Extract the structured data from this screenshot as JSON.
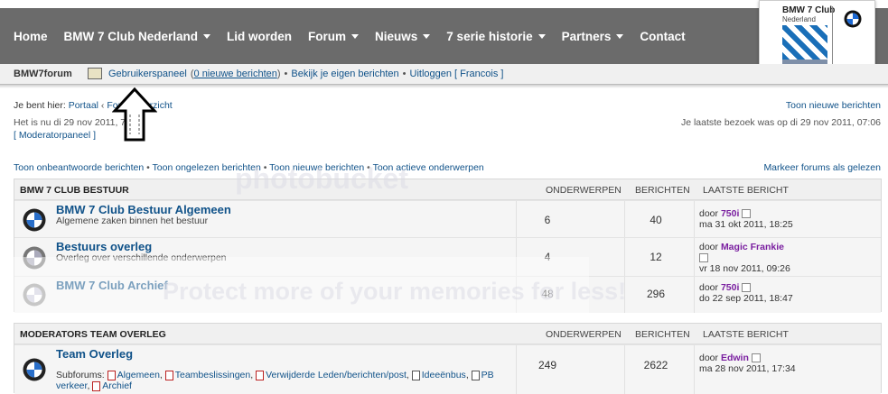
{
  "nav": {
    "items": [
      {
        "label": "Home",
        "dropdown": false
      },
      {
        "label": "BMW 7 Club Nederland",
        "dropdown": true
      },
      {
        "label": "Lid worden",
        "dropdown": false
      },
      {
        "label": "Forum",
        "dropdown": true
      },
      {
        "label": "Nieuws",
        "dropdown": true
      },
      {
        "label": "7 serie historie",
        "dropdown": true
      },
      {
        "label": "Partners",
        "dropdown": true
      },
      {
        "label": "Contact",
        "dropdown": false
      }
    ],
    "logo": {
      "line1": "BMW 7 Club",
      "line2": "Nederland"
    }
  },
  "subbar": {
    "forum_name": "BMW7forum",
    "ucp_label": "Gebruikerspaneel",
    "new_messages_pre": "(",
    "new_messages": "0 nieuwe berichten",
    "new_messages_post": ")",
    "own_posts": "Bekijk je eigen berichten",
    "logout": "Uitloggen [ Francois ]",
    "sep": "•"
  },
  "location": {
    "prefix": "Je bent hier:",
    "portal": "Portaal",
    "sep": "‹",
    "forum_overview": "Forumoverzicht",
    "new_posts_right": "Toon nieuwe berichten",
    "now": "Het is nu di 29 nov 2011, 7:55",
    "last_visit": "Je laatste bezoek was op di 29 nov 2011, 07:06",
    "mod_panel": "[ Moderatorpaneel ]"
  },
  "quicklinks": {
    "unanswered": "Toon onbeantwoorde berichten",
    "unread": "Toon ongelezen berichten",
    "new": "Toon nieuwe berichten",
    "active": "Toon actieve onderwerpen",
    "mark_read": "Markeer forums als gelezen",
    "sep": "•"
  },
  "headers": {
    "topics": "ONDERWERPEN",
    "posts": "BERICHTEN",
    "last": "LAATSTE BERICHT"
  },
  "categories": [
    {
      "name": "BMW 7 CLUB BESTUUR",
      "forums": [
        {
          "title": "BMW 7 Club Bestuur Algemeen",
          "desc": "Algemene zaken binnen het bestuur",
          "topics": "6",
          "posts": "40",
          "by": "door",
          "user": "750i",
          "date": "ma 31 okt 2011, 18:25"
        },
        {
          "title": "Bestuurs overleg",
          "desc": "Overleg over verschillende onderwerpen",
          "topics": "4",
          "posts": "12",
          "by": "door",
          "user": "Magic Frankie",
          "date": "vr 18 nov 2011, 09:26"
        },
        {
          "title": "BMW 7 Club Archief",
          "desc": "",
          "topics": "48",
          "posts": "296",
          "by": "door",
          "user": "750i",
          "date": "do 22 sep 2011, 18:47"
        }
      ]
    },
    {
      "name": "MODERATORS TEAM OVERLEG",
      "forums": [
        {
          "title": "Team Overleg",
          "subforums_label": "Subforums:",
          "subforums": [
            "Algemeen",
            "Teambeslissingen",
            "Verwijderde Leden/berichten/post",
            "Ideeënbus",
            "PB verkeer",
            "Archief"
          ],
          "topics": "249",
          "posts": "2622",
          "by": "door",
          "user": "Edwin",
          "date": "ma 28 nov 2011, 17:34"
        }
      ]
    }
  ],
  "watermark": {
    "line1": "photobucket",
    "line2": "Protect more of your memories for less!"
  },
  "colors": {
    "nav_bg": "#6b6b6b",
    "link": "#105289",
    "user": "#7a1fa0"
  }
}
